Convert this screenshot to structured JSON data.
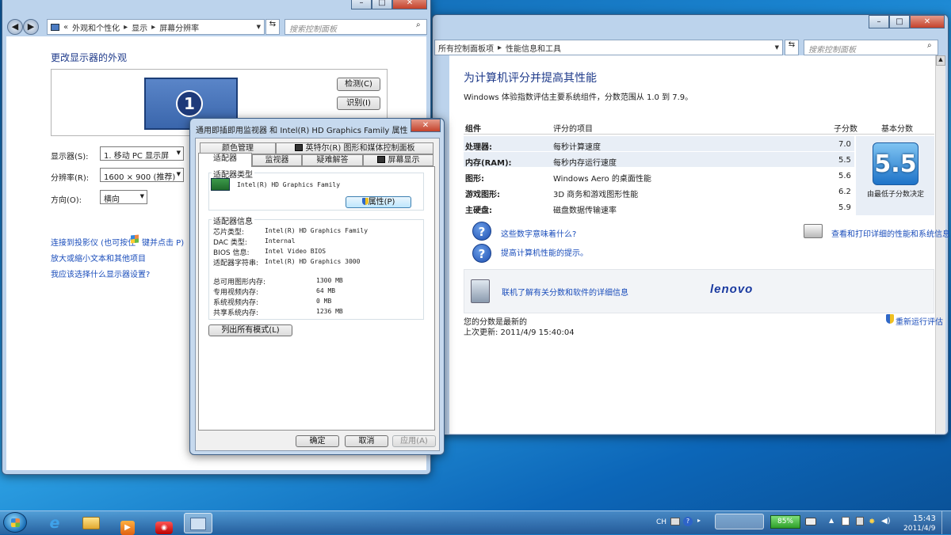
{
  "left_window": {
    "breadcrumb": [
      "«",
      "外观和个性化",
      "显示",
      "屏幕分辨率"
    ],
    "search_placeholder": "搜索控制面板",
    "heading": "更改显示器的外观",
    "monitor_number": "1",
    "detect_label": "检测(C)",
    "identify_label": "识别(I)",
    "display_label": "显示器(S):",
    "display_value": "1. 移动 PC 显示屏",
    "resolution_label": "分辨率(R):",
    "resolution_value": "1600 × 900 (推荐)",
    "orientation_label": "方向(O):",
    "orientation_value": "横向",
    "links": [
      "连接到投影仪 (也可按住",
      "键并点击 P)",
      "放大或缩小文本和其他项目",
      "我应该选择什么显示器设置?"
    ]
  },
  "right_window": {
    "breadcrumb": [
      "所有控制面板项",
      "性能信息和工具"
    ],
    "search_placeholder": "搜索控制面板",
    "title": "为计算机评分并提高其性能",
    "subtitle": "Windows 体验指数评估主要系统组件，分数范围从 1.0 到 7.9。",
    "headers": {
      "component": "组件",
      "rated": "评分的项目",
      "subscore": "子分数",
      "base": "基本分数"
    },
    "rows": [
      {
        "component": "处理器:",
        "rated": "每秒计算速度",
        "score": "7.0"
      },
      {
        "component": "内存(RAM):",
        "rated": "每秒内存运行速度",
        "score": "5.5"
      },
      {
        "component": "图形:",
        "rated": "Windows Aero 的桌面性能",
        "score": "5.6"
      },
      {
        "component": "游戏图形:",
        "rated": "3D 商务和游戏图形性能",
        "score": "6.2"
      },
      {
        "component": "主硬盘:",
        "rated": "磁盘数据传输速率",
        "score": "5.9"
      }
    ],
    "base_score": "5.5",
    "base_note": "由最低子分数决定",
    "link_meaning": "这些数字意味着什么?",
    "link_print": "查看和打印详细的性能和系统信息",
    "link_tips": "提高计算机性能的提示。",
    "link_online": "联机了解有关分数和软件的详细信息",
    "brand": "lenovo",
    "status": "您的分数是最新的",
    "last_update": "上次更新: 2011/4/9 15:40:04",
    "rerun": "重新运行评估"
  },
  "dialog": {
    "title": "通用即插即用监视器 和 Intel(R) HD Graphics Family 属性",
    "tabs_row1": [
      "颜色管理",
      "英特尔(R) 图形和媒体控制面板"
    ],
    "tabs_row2": [
      "适配器",
      "监视器",
      "疑难解答",
      "屏幕显示"
    ],
    "adapter_type_label": "适配器类型",
    "adapter_name": "Intel(R) HD Graphics Family",
    "properties_button": "属性(P)",
    "adapter_info_label": "适配器信息",
    "info": [
      {
        "k": "芯片类型:",
        "v": "Intel(R) HD Graphics Family"
      },
      {
        "k": "DAC 类型:",
        "v": "Internal"
      },
      {
        "k": "BIOS 信息:",
        "v": "Intel Video BIOS"
      },
      {
        "k": "适配器字符串:",
        "v": "Intel(R) HD Graphics 3000"
      }
    ],
    "memory": [
      {
        "k": "总可用图形内存:",
        "v": "1300 MB"
      },
      {
        "k": "专用视频内存:",
        "v": "64 MB"
      },
      {
        "k": "系统视频内存:",
        "v": "0 MB"
      },
      {
        "k": "共享系统内存:",
        "v": "1236 MB"
      }
    ],
    "list_modes_button": "列出所有模式(L)",
    "ok": "确定",
    "cancel": "取消",
    "apply": "应用(A)"
  },
  "taskbar": {
    "lang": "CH",
    "battery": "85%",
    "time": "15:43",
    "date": "2011/4/9"
  }
}
